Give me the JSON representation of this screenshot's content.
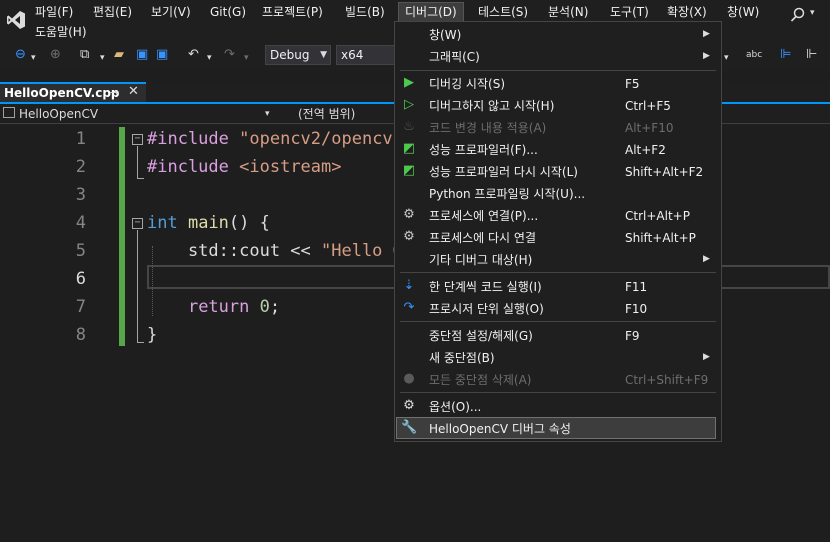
{
  "menubar": {
    "items": [
      "파일(F)",
      "편집(E)",
      "보기(V)",
      "Git(G)",
      "프로젝트(P)",
      "빌드(B)",
      "디버그(D)",
      "테스트(S)",
      "분석(N)",
      "도구(T)",
      "확장(X)",
      "창(W)",
      "도움말(H)"
    ]
  },
  "toolbar": {
    "config": "Debug",
    "platform": "x64"
  },
  "tab": {
    "label": "HelloOpenCV.cpp",
    "pin": "⊸",
    "close": "✕"
  },
  "navbar": {
    "project": "HelloOpenCV",
    "scope": "(전역 범위)"
  },
  "editor": {
    "line_numbers": [
      "1",
      "2",
      "3",
      "4",
      "5",
      "6",
      "7",
      "8"
    ]
  },
  "debug_menu": {
    "items": [
      {
        "label": "창(W)",
        "shortcut": "",
        "submenu": true,
        "disabled": false,
        "icon": ""
      },
      {
        "label": "그래픽(C)",
        "shortcut": "",
        "submenu": true,
        "disabled": false,
        "icon": ""
      },
      {
        "label": "디버깅 시작(S)",
        "shortcut": "F5",
        "submenu": false,
        "disabled": false,
        "icon": "play-icon"
      },
      {
        "label": "디버그하지 않고 시작(H)",
        "shortcut": "Ctrl+F5",
        "submenu": false,
        "disabled": false,
        "icon": "play-outline-icon"
      },
      {
        "label": "코드 변경 내용 적용(A)",
        "shortcut": "Alt+F10",
        "submenu": false,
        "disabled": true,
        "icon": "flame-icon"
      },
      {
        "label": "성능 프로파일러(F)...",
        "shortcut": "Alt+F2",
        "submenu": false,
        "disabled": false,
        "icon": "profiler-icon"
      },
      {
        "label": "성능 프로파일러 다시 시작(L)",
        "shortcut": "Shift+Alt+F2",
        "submenu": false,
        "disabled": false,
        "icon": "profiler-restart-icon"
      },
      {
        "label": "Python 프로파일링 시작(U)...",
        "shortcut": "",
        "submenu": false,
        "disabled": false,
        "icon": ""
      },
      {
        "label": "프로세스에 연결(P)...",
        "shortcut": "Ctrl+Alt+P",
        "submenu": false,
        "disabled": false,
        "icon": "attach-gear-icon"
      },
      {
        "label": "프로세스에 다시 연결",
        "shortcut": "Shift+Alt+P",
        "submenu": false,
        "disabled": false,
        "icon": "reattach-gear-icon"
      },
      {
        "label": "기타 디버그 대상(H)",
        "shortcut": "",
        "submenu": true,
        "disabled": false,
        "icon": ""
      },
      {
        "label": "한 단계씩 코드 실행(I)",
        "shortcut": "F11",
        "submenu": false,
        "disabled": false,
        "icon": "step-into-icon"
      },
      {
        "label": "프로시저 단위 실행(O)",
        "shortcut": "F10",
        "submenu": false,
        "disabled": false,
        "icon": "step-over-icon"
      },
      {
        "label": "중단점 설정/해제(G)",
        "shortcut": "F9",
        "submenu": false,
        "disabled": false,
        "icon": ""
      },
      {
        "label": "새 중단점(B)",
        "shortcut": "",
        "submenu": true,
        "disabled": false,
        "icon": ""
      },
      {
        "label": "모든 중단점 삭제(A)",
        "shortcut": "Ctrl+Shift+F9",
        "submenu": false,
        "disabled": true,
        "icon": "delete-breakpoints-icon"
      },
      {
        "label": "옵션(O)...",
        "shortcut": "",
        "submenu": false,
        "disabled": false,
        "icon": "gear-icon"
      },
      {
        "label": "HelloOpenCV 디버그 속성",
        "shortcut": "",
        "submenu": false,
        "disabled": false,
        "icon": "wrench-icon"
      }
    ]
  },
  "colors": {
    "accent": "#0097fb",
    "change_bar": "#57a64a",
    "keyword": "#569cd6",
    "string": "#d69d85"
  }
}
